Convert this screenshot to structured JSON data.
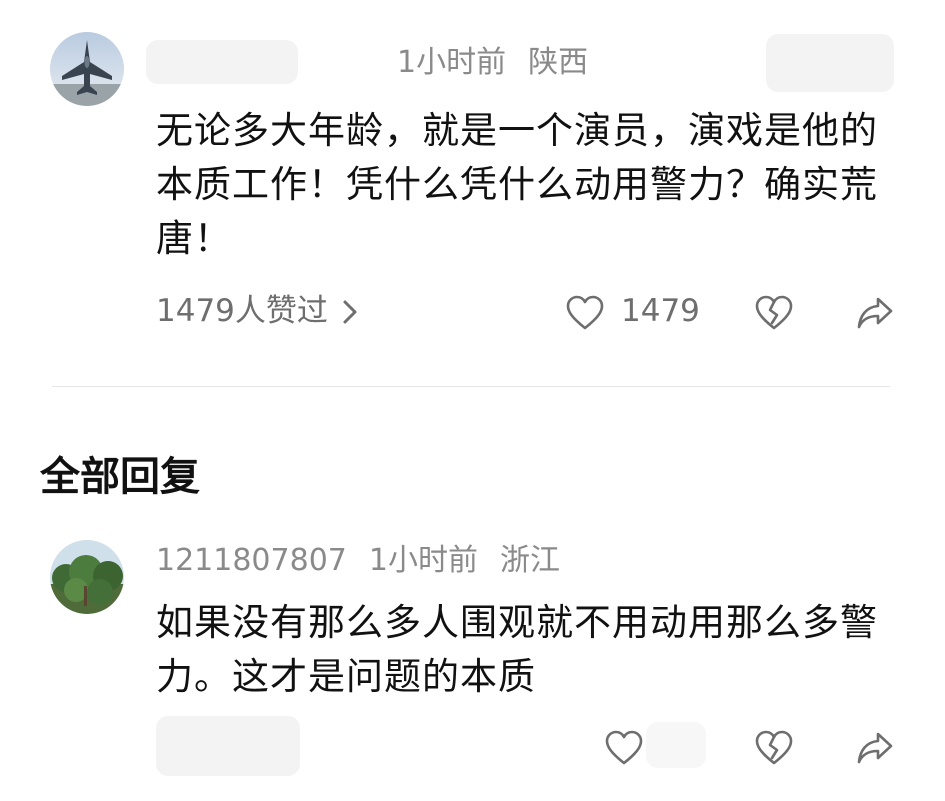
{
  "comment": {
    "time": "1小时前",
    "location": "陕西",
    "content": "无论多大年龄，就是一个演员，演戏是他的本质工作！凭什么凭什么动用警力？确实荒唐！",
    "liked_by": "1479人赞过",
    "like_count": "1479"
  },
  "replies_section": {
    "title": "全部回复"
  },
  "reply": {
    "username": "1211807807",
    "time": "1小时前",
    "location": "浙江",
    "content": "如果没有那么多人围观就不用动用那么多警力。这才是问题的本质"
  },
  "colors": {
    "meta_gray": "#8a8a8a",
    "text": "#111111",
    "icon_gray": "#6e6e6e",
    "divider": "#e6e6e6"
  },
  "icons": [
    "jet-avatar",
    "chevron-right-icon",
    "heart-icon",
    "broken-heart-icon",
    "share-icon",
    "forest-avatar"
  ]
}
